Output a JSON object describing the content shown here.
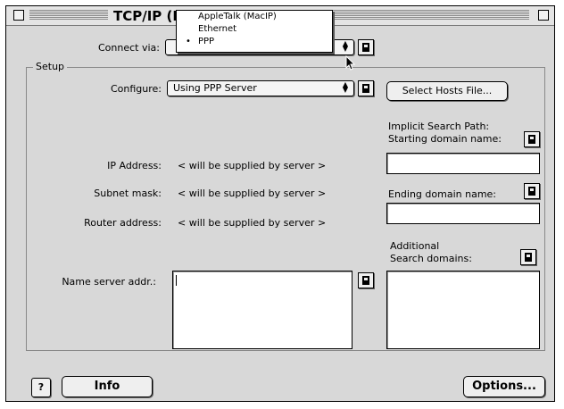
{
  "window": {
    "title": "TCP/IP (Prodigy Infinitum)"
  },
  "connect_via": {
    "label": "Connect via:"
  },
  "dropdown_menu": {
    "items": [
      {
        "label": "AppleTalk (MacIP)",
        "selected": ""
      },
      {
        "label": "Ethernet",
        "selected": ""
      },
      {
        "label": "PPP",
        "selected": "•"
      }
    ]
  },
  "setup": {
    "group_label": "Setup",
    "configure_label": "Configure:",
    "configure_value": "Using PPP Server",
    "select_hosts_button": "Select Hosts File...",
    "implicit_search_label_1": "Implicit Search Path:",
    "implicit_search_label_2": "Starting domain name:",
    "ip_label": "IP Address:",
    "ip_value": "< will be supplied by server >",
    "subnet_label": "Subnet mask:",
    "subnet_value": "< will be supplied by server >",
    "router_label": "Router address:",
    "router_value": "< will be supplied by server >",
    "ending_domain_label": "Ending domain name:",
    "name_server_label": "Name server addr.:",
    "additional_label_1": "Additional",
    "additional_label_2": "Search domains:"
  },
  "footer": {
    "help_glyph": "?",
    "info_button": "Info",
    "options_button": "Options..."
  }
}
